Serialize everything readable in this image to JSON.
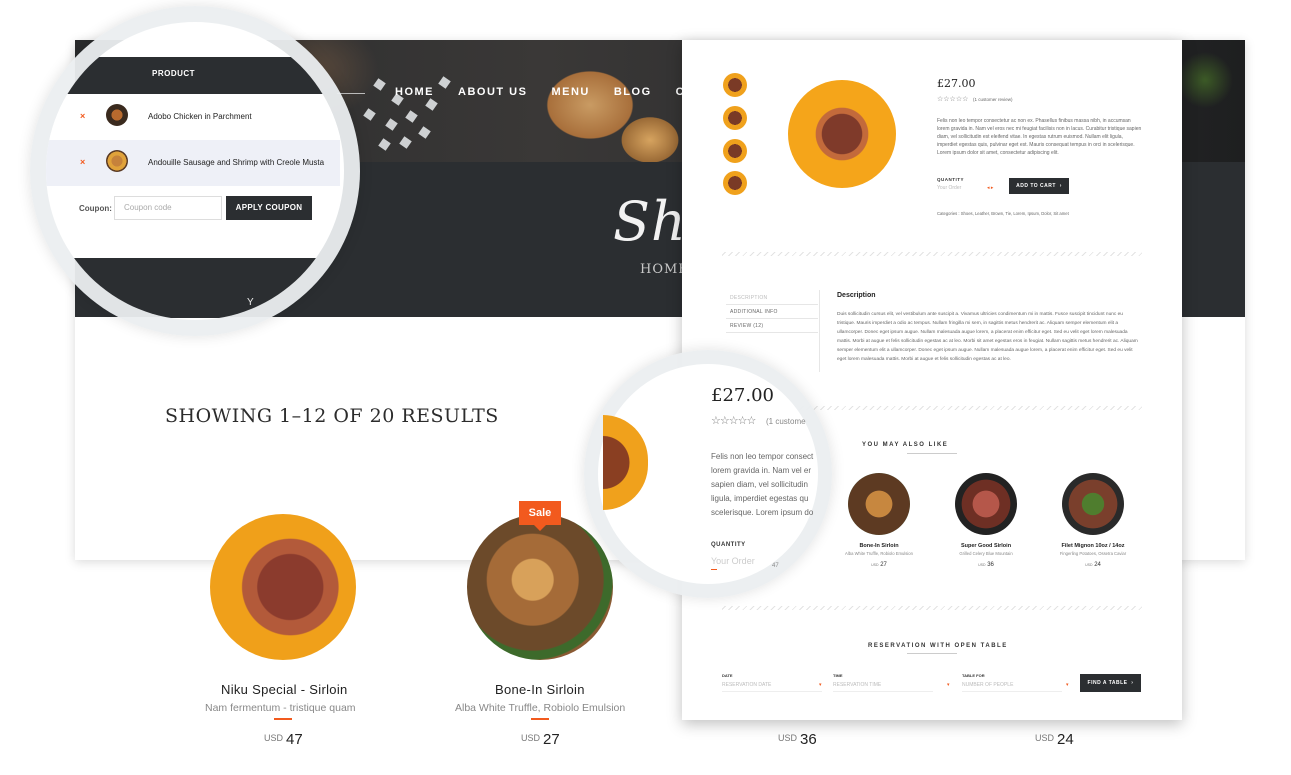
{
  "nav": {
    "items": [
      "HOME",
      "ABOUT US",
      "MENU",
      "BLOG",
      "C"
    ]
  },
  "hero": {
    "title": "Sho",
    "breadcrumb": "HOME/S"
  },
  "results": {
    "title": "SHOWING 1–12 OF 20 RESULTS"
  },
  "products": [
    {
      "name": "Niku Special - Sirloin",
      "subtitle": "Nam fermentum - tristique quam",
      "currency": "USD",
      "price": "47",
      "sale": ""
    },
    {
      "name": "Bone-In Sirloin",
      "subtitle": "Alba White Truffle, Robiolo Emulsion",
      "currency": "USD",
      "price": "27",
      "sale": "Sale"
    },
    {
      "name": "",
      "subtitle": "",
      "currency": "USD",
      "price": "36",
      "sale": ""
    },
    {
      "name": "",
      "subtitle": "",
      "currency": "USD",
      "price": "24",
      "sale": ""
    }
  ],
  "cart": {
    "header": "PRODUCT",
    "rows": [
      {
        "remove": "×",
        "name": "Adobo Chicken in Parchment"
      },
      {
        "remove": "×",
        "name": "Andouille Sausage and Shrimp with Creole Musta"
      }
    ],
    "coupon_label": "Coupon:",
    "coupon_placeholder": "Coupon code",
    "apply_button": "APPLY COUPON",
    "partial_text": "Y"
  },
  "detail": {
    "price": "£27.00",
    "stars": "☆☆☆☆☆",
    "review_count": "(1 customer review)",
    "description_short": "Felis non leo tempor consectetur ac non ex. Phasellus finibus massa nibh, in accumsan lorem gravida in. Nam vel eros nec mi feugiat facilisis non in lacus. Curabitur tristique sapien diam, vel sollicitudin est eleifend vitae. In egestas rutrum euismod. Nullam elit ligula, imperdiet egestas quis, pulvinar eget est. Mauris consequat tempus in orci in scelerisque. Lorem ipsum dolor sit amet, consectetur adipiscing elit.",
    "quantity_label": "QUANTITY",
    "quantity_placeholder": "Your Order",
    "add_to_cart": "ADD TO CART",
    "categories": "Categories : Shoes, Leather, Brown, Tie, Lorem, Ipsum, Dolor, Sit amet",
    "tabs": [
      "DESCRIPTION",
      "ADDITIONAL INFO",
      "REVIEW (12)"
    ],
    "description_title": "Description",
    "description_body": "Duis sollicitudin cursus elit, vel vestibulum ante suscipit a. Vivamus ultricies condimentum mi in mattis. Fusce suscipit tincidunt nunc eu tristique. Mauris imperdiet a odio ac tempus. Nullam fringilla mi sem, in sagittis metus hendrerit ac. Aliquam semper elementum elit a ullamcorper. Donec eget ipsum augue. Nullam malesuada augue lorem, a placerat enim efficitur eget. Sed eu velit eget lorem malesuada mattis. Morbi at augue et felis sollicitudin egestas ac at leo. Morbi sit amet egestas eros in feugiat. Nullam sagittis metus hendrerit ac. Aliquam semper elementum elit a ullamcorper. Donec eget ipsum augue. Nullam malesuada augue lorem, a placerat enim efficitur eget. Sed eu velit eget lorem malesuada mattis. Morbi at augue et felis sollicitudin egestas ac at leo.",
    "ymal_title": "YOU MAY ALSO LIKE",
    "ymal": [
      {
        "name": "Bone-In Sirloin",
        "sub": "Alba White Truffle, Robiolo Emulsion",
        "currency": "USD",
        "price": "27"
      },
      {
        "name": "Super Good Sirloin",
        "sub": "Grilled Celery Blue Mountain",
        "currency": "USD",
        "price": "36"
      },
      {
        "name": "Filet Mignon 10oz / 14oz",
        "sub": "Fingerling Potatoes, Ossetra Caviar",
        "currency": "USD",
        "price": "24"
      }
    ],
    "reservation_title": "RESERVATION WITH OPEN TABLE",
    "reservation": [
      {
        "label": "DATE",
        "placeholder": "RESERVATION DATE"
      },
      {
        "label": "TIME",
        "placeholder": "RESERVATION TIME"
      },
      {
        "label": "TABLE FOR",
        "placeholder": "NUMBER OF PEOPLE"
      }
    ],
    "find_table": "FIND A TABLE"
  },
  "lens2": {
    "price": "£27.00",
    "stars": "☆☆☆☆☆",
    "review": "(1 custome",
    "lines": [
      "Felis non leo tempor consect",
      "lorem gravida in. Nam vel er",
      "sapien diam, vel sollicitudin",
      "ligula, imperdiet egestas qu",
      "scelerisque. Lorem ipsum do"
    ],
    "quantity_label": "QUANTITY",
    "order": "Your Order",
    "partial_num": "47"
  },
  "colors": {
    "accent": "#f25a1e",
    "dark": "#2b2e31"
  }
}
